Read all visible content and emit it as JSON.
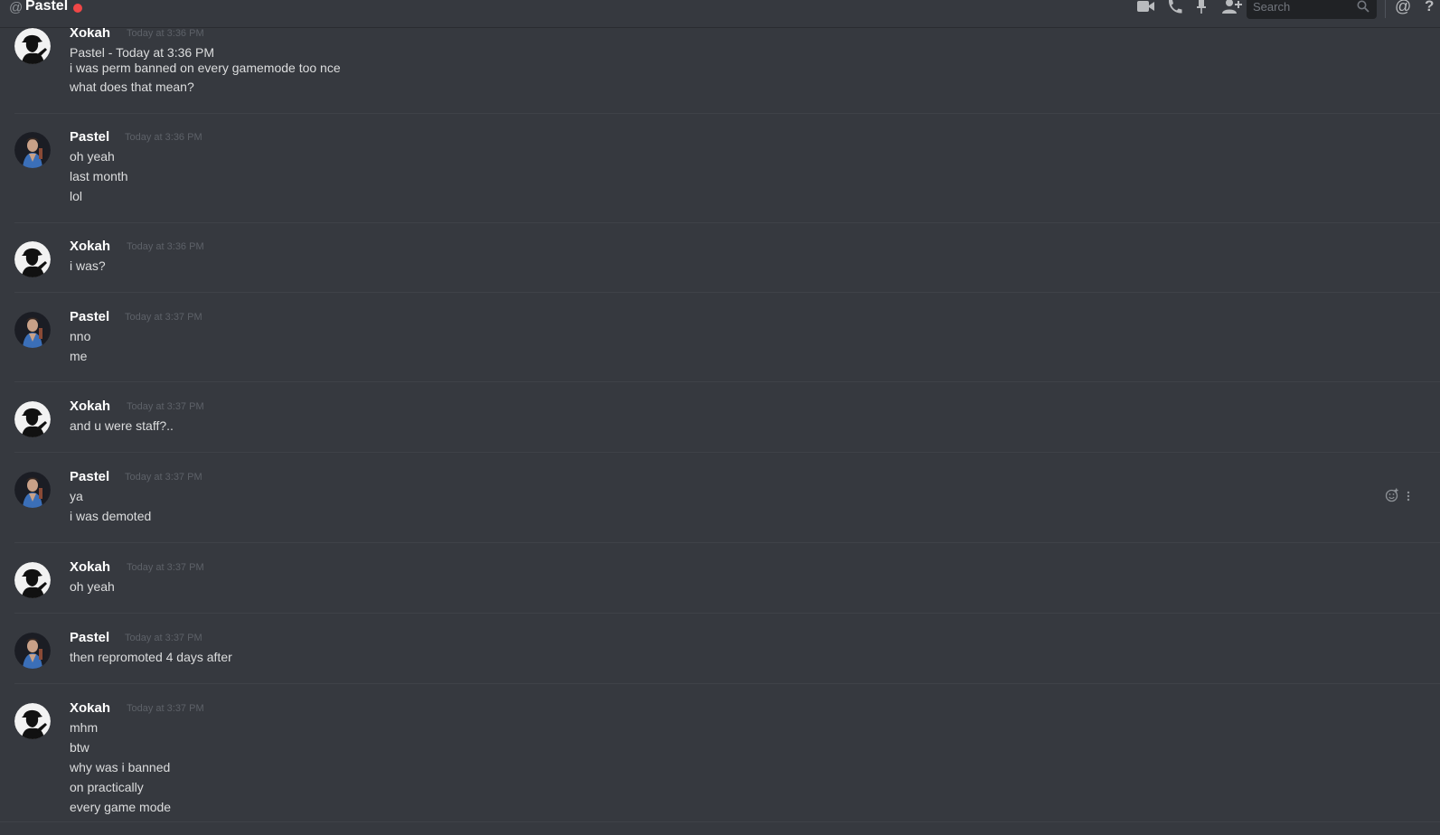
{
  "header": {
    "at_symbol": "@",
    "channel_name": "Pastel",
    "search_placeholder": "Search",
    "status_color": "#f04747",
    "icons": [
      "video-icon",
      "phone-icon",
      "pin-icon",
      "add-friend-icon",
      "search-icon",
      "mention-icon",
      "help-icon"
    ],
    "mention_label": "@",
    "help_label": "?"
  },
  "messages": [
    {
      "author": "Xokah",
      "avatar": "xokah-avatar",
      "timestamp": "Today at 3:36 PM",
      "lines": [
        "Pastel - Today at 3:36 PM",
        "i was perm banned on every gamemode too nce",
        "what does that mean?"
      ]
    },
    {
      "author": "Pastel",
      "avatar": "pastel-avatar",
      "timestamp": "Today at 3:36 PM",
      "lines": [
        "oh yeah",
        "last month",
        "lol"
      ]
    },
    {
      "author": "Xokah",
      "avatar": "xokah-avatar",
      "timestamp": "Today at 3:36 PM",
      "lines": [
        "i was?"
      ]
    },
    {
      "author": "Pastel",
      "avatar": "pastel-avatar",
      "timestamp": "Today at 3:37 PM",
      "lines": [
        "nno",
        "me"
      ]
    },
    {
      "author": "Xokah",
      "avatar": "xokah-avatar",
      "timestamp": "Today at 3:37 PM",
      "lines": [
        "and u were staff?.."
      ]
    },
    {
      "author": "Pastel",
      "avatar": "pastel-avatar",
      "timestamp": "Today at 3:37 PM",
      "lines": [
        "ya",
        "i was demoted"
      ]
    },
    {
      "author": "Xokah",
      "avatar": "xokah-avatar",
      "timestamp": "Today at 3:37 PM",
      "lines": [
        "oh yeah"
      ]
    },
    {
      "author": "Pastel",
      "avatar": "pastel-avatar",
      "timestamp": "Today at 3:37 PM",
      "lines": [
        "then repromoted 4 days after"
      ]
    },
    {
      "author": "Xokah",
      "avatar": "xokah-avatar",
      "timestamp": "Today at 3:37 PM",
      "lines": [
        "mhm",
        "btw",
        "why was i banned",
        "on practically",
        "every game mode"
      ]
    }
  ],
  "hover_actions": {
    "icons": [
      "add-reaction-icon",
      "more-options-icon"
    ]
  }
}
